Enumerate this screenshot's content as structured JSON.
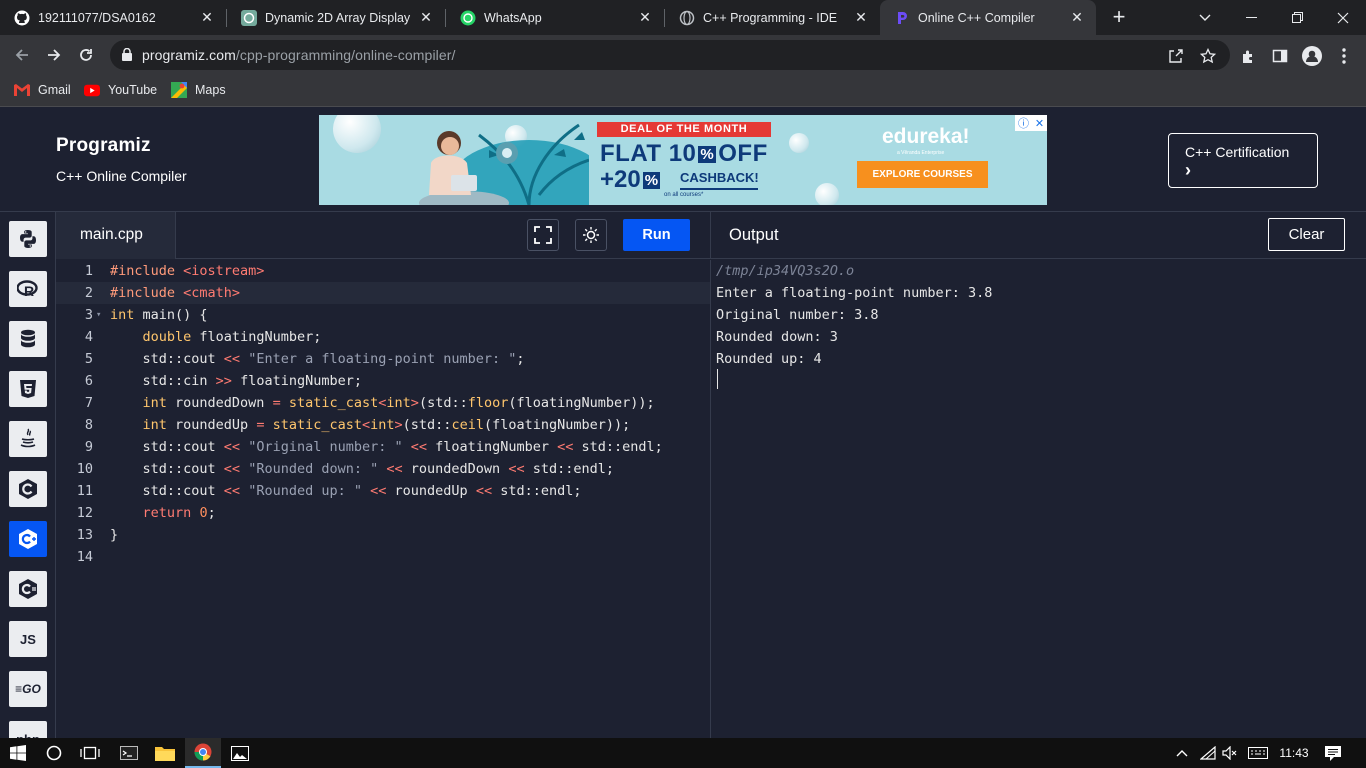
{
  "browser": {
    "tabs": [
      {
        "title": "192111077/DSA0162",
        "favicon": "github-icon",
        "active": false
      },
      {
        "title": "Dynamic 2D Array Display",
        "favicon": "chatgpt-icon",
        "active": false
      },
      {
        "title": "WhatsApp",
        "favicon": "whatsapp-icon",
        "active": false
      },
      {
        "title": "C++ Programming - IDE",
        "favicon": "globe-icon",
        "active": false
      },
      {
        "title": "Online C++ Compiler",
        "favicon": "programiz-icon",
        "active": true
      }
    ],
    "url_domain": "programiz.com",
    "url_path": "/cpp-programming/online-compiler/",
    "bookmarks": [
      {
        "label": "Gmail",
        "icon": "gmail-icon"
      },
      {
        "label": "YouTube",
        "icon": "youtube-icon"
      },
      {
        "label": "Maps",
        "icon": "maps-icon"
      }
    ]
  },
  "site": {
    "logo": "Programiz",
    "subtitle": "C++ Online Compiler",
    "certification_button": "C++ Certification",
    "certification_arrow": "›",
    "ad": {
      "deal": "DEAL OF THE MONTH",
      "flat_prefix": "FLAT 10",
      "flat_suffix": "OFF",
      "extra": "+20",
      "percent": "%",
      "cashback": "CASHBACK!",
      "courses_note": "on all courses*",
      "brand": "edureka!",
      "brand_tagline": "a Vêranda Enterprise",
      "cta": "EXPLORE COURSES"
    }
  },
  "sidebar": {
    "languages": [
      {
        "name": "python",
        "icon": "python-icon",
        "label": "",
        "active": false
      },
      {
        "name": "r",
        "icon": "r-icon",
        "label": "",
        "active": false
      },
      {
        "name": "sql",
        "icon": "database-icon",
        "label": "",
        "active": false
      },
      {
        "name": "html",
        "icon": "html5-icon",
        "label": "",
        "active": false
      },
      {
        "name": "java",
        "icon": "java-icon",
        "label": "",
        "active": false
      },
      {
        "name": "c",
        "icon": "c-icon",
        "label": "",
        "active": false
      },
      {
        "name": "cpp",
        "icon": "cpp-icon",
        "label": "",
        "active": true
      },
      {
        "name": "csharp",
        "icon": "csharp-icon",
        "label": "",
        "active": false
      },
      {
        "name": "javascript",
        "icon": "js-icon",
        "label": "JS",
        "active": false
      },
      {
        "name": "go",
        "icon": "go-icon",
        "label": "GO",
        "active": false
      },
      {
        "name": "php",
        "icon": "php-icon",
        "label": "php",
        "active": false
      }
    ]
  },
  "editor": {
    "file_name": "main.cpp",
    "run_label": "Run",
    "highlighted_line": 2,
    "lines": [
      [
        [
          "inc",
          "#include "
        ],
        [
          "op",
          "<iostream>"
        ]
      ],
      [
        [
          "inc",
          "#include "
        ],
        [
          "op",
          "<cmath>"
        ]
      ],
      [
        [
          "kw",
          "int"
        ],
        [
          "t",
          " main() {"
        ]
      ],
      [
        [
          "t",
          "    "
        ],
        [
          "kw",
          "double"
        ],
        [
          "t",
          " floatingNumber;"
        ]
      ],
      [
        [
          "t",
          "    std::cout "
        ],
        [
          "op",
          "<<"
        ],
        [
          "t",
          " "
        ],
        [
          "str",
          "\"Enter a floating-point number: \""
        ],
        [
          "t",
          ";"
        ]
      ],
      [
        [
          "t",
          "    std::cin "
        ],
        [
          "op",
          ">>"
        ],
        [
          "t",
          " floatingNumber;"
        ]
      ],
      [
        [
          "t",
          "    "
        ],
        [
          "kw",
          "int"
        ],
        [
          "t",
          " roundedDown "
        ],
        [
          "op",
          "="
        ],
        [
          "t",
          " "
        ],
        [
          "fn",
          "static_cast"
        ],
        [
          "op",
          "<"
        ],
        [
          "kw",
          "int"
        ],
        [
          "op",
          ">"
        ],
        [
          "t",
          "(std::"
        ],
        [
          "fn",
          "floor"
        ],
        [
          "t",
          "(floatingNumber));"
        ]
      ],
      [
        [
          "t",
          "    "
        ],
        [
          "kw",
          "int"
        ],
        [
          "t",
          " roundedUp "
        ],
        [
          "op",
          "="
        ],
        [
          "t",
          " "
        ],
        [
          "fn",
          "static_cast"
        ],
        [
          "op",
          "<"
        ],
        [
          "kw",
          "int"
        ],
        [
          "op",
          ">"
        ],
        [
          "t",
          "(std::"
        ],
        [
          "fn",
          "ceil"
        ],
        [
          "t",
          "(floatingNumber));"
        ]
      ],
      [
        [
          "t",
          "    std::cout "
        ],
        [
          "op",
          "<<"
        ],
        [
          "t",
          " "
        ],
        [
          "str",
          "\"Original number: \""
        ],
        [
          "t",
          " "
        ],
        [
          "op",
          "<<"
        ],
        [
          "t",
          " floatingNumber "
        ],
        [
          "op",
          "<<"
        ],
        [
          "t",
          " std::endl;"
        ]
      ],
      [
        [
          "t",
          "    std::cout "
        ],
        [
          "op",
          "<<"
        ],
        [
          "t",
          " "
        ],
        [
          "str",
          "\"Rounded down: \""
        ],
        [
          "t",
          " "
        ],
        [
          "op",
          "<<"
        ],
        [
          "t",
          " roundedDown "
        ],
        [
          "op",
          "<<"
        ],
        [
          "t",
          " std::endl;"
        ]
      ],
      [
        [
          "t",
          "    std::cout "
        ],
        [
          "op",
          "<<"
        ],
        [
          "t",
          " "
        ],
        [
          "str",
          "\"Rounded up: \""
        ],
        [
          "t",
          " "
        ],
        [
          "op",
          "<<"
        ],
        [
          "t",
          " roundedUp "
        ],
        [
          "op",
          "<<"
        ],
        [
          "t",
          " std::endl;"
        ]
      ],
      [
        [
          "t",
          "    "
        ],
        [
          "op",
          "return"
        ],
        [
          "t",
          " "
        ],
        [
          "num",
          "0"
        ],
        [
          "t",
          ";"
        ]
      ],
      [
        [
          "t",
          "}"
        ]
      ],
      []
    ]
  },
  "output": {
    "title": "Output",
    "clear_label": "Clear",
    "lines": [
      {
        "text": "/tmp/ip34VQ3s2O.o",
        "kind": "path"
      },
      {
        "text": "Enter a floating-point number: 3.8",
        "kind": "text"
      },
      {
        "text": "Original number: 3.8",
        "kind": "text"
      },
      {
        "text": "Rounded down: 3",
        "kind": "text"
      },
      {
        "text": "Rounded up: 4",
        "kind": "text"
      }
    ]
  },
  "taskbar": {
    "clock": "11:43"
  },
  "colors": {
    "accent": "#0556f3",
    "background": "#1d2131"
  }
}
